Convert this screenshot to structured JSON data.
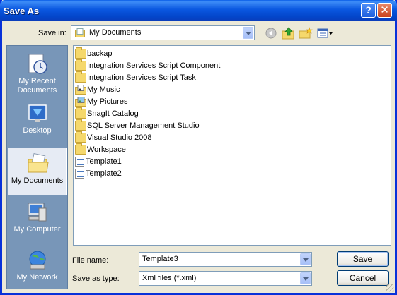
{
  "window": {
    "title": "Save As",
    "help": "?",
    "close": "✕"
  },
  "save_in": {
    "label": "Save in:",
    "value": "My Documents"
  },
  "toolbar": {
    "back_icon": "back-arrow-icon",
    "up_icon": "up-one-level-icon",
    "new_folder_icon": "new-folder-icon",
    "views_icon": "views-menu-icon"
  },
  "places": [
    {
      "label": "My Recent Documents",
      "icon": "recent-documents-icon"
    },
    {
      "label": "Desktop",
      "icon": "desktop-icon"
    },
    {
      "label": "My Documents",
      "icon": "my-documents-icon",
      "selected": true
    },
    {
      "label": "My Computer",
      "icon": "my-computer-icon"
    },
    {
      "label": "My Network",
      "icon": "my-network-icon"
    }
  ],
  "files": [
    {
      "name": "backap",
      "type": "folder"
    },
    {
      "name": "Integration Services Script Component",
      "type": "folder"
    },
    {
      "name": "Integration Services Script Task",
      "type": "folder"
    },
    {
      "name": "My Music",
      "type": "music-folder"
    },
    {
      "name": "My Pictures",
      "type": "pictures-folder"
    },
    {
      "name": "SnagIt Catalog",
      "type": "folder"
    },
    {
      "name": "SQL Server Management Studio",
      "type": "folder"
    },
    {
      "name": "Visual Studio 2008",
      "type": "folder"
    },
    {
      "name": "Workspace",
      "type": "folder"
    },
    {
      "name": "Template1",
      "type": "xml"
    },
    {
      "name": "Template2",
      "type": "xml"
    }
  ],
  "file_name": {
    "label": "File name:",
    "value": "Template3"
  },
  "save_as_type": {
    "label": "Save as type:",
    "value": "Xml files (*.xml)"
  },
  "buttons": {
    "save": "Save",
    "cancel": "Cancel"
  },
  "colors": {
    "title_bar": "#0a57e0",
    "places_bar": "#7896b8",
    "dialog_bg": "#ece9d8"
  }
}
